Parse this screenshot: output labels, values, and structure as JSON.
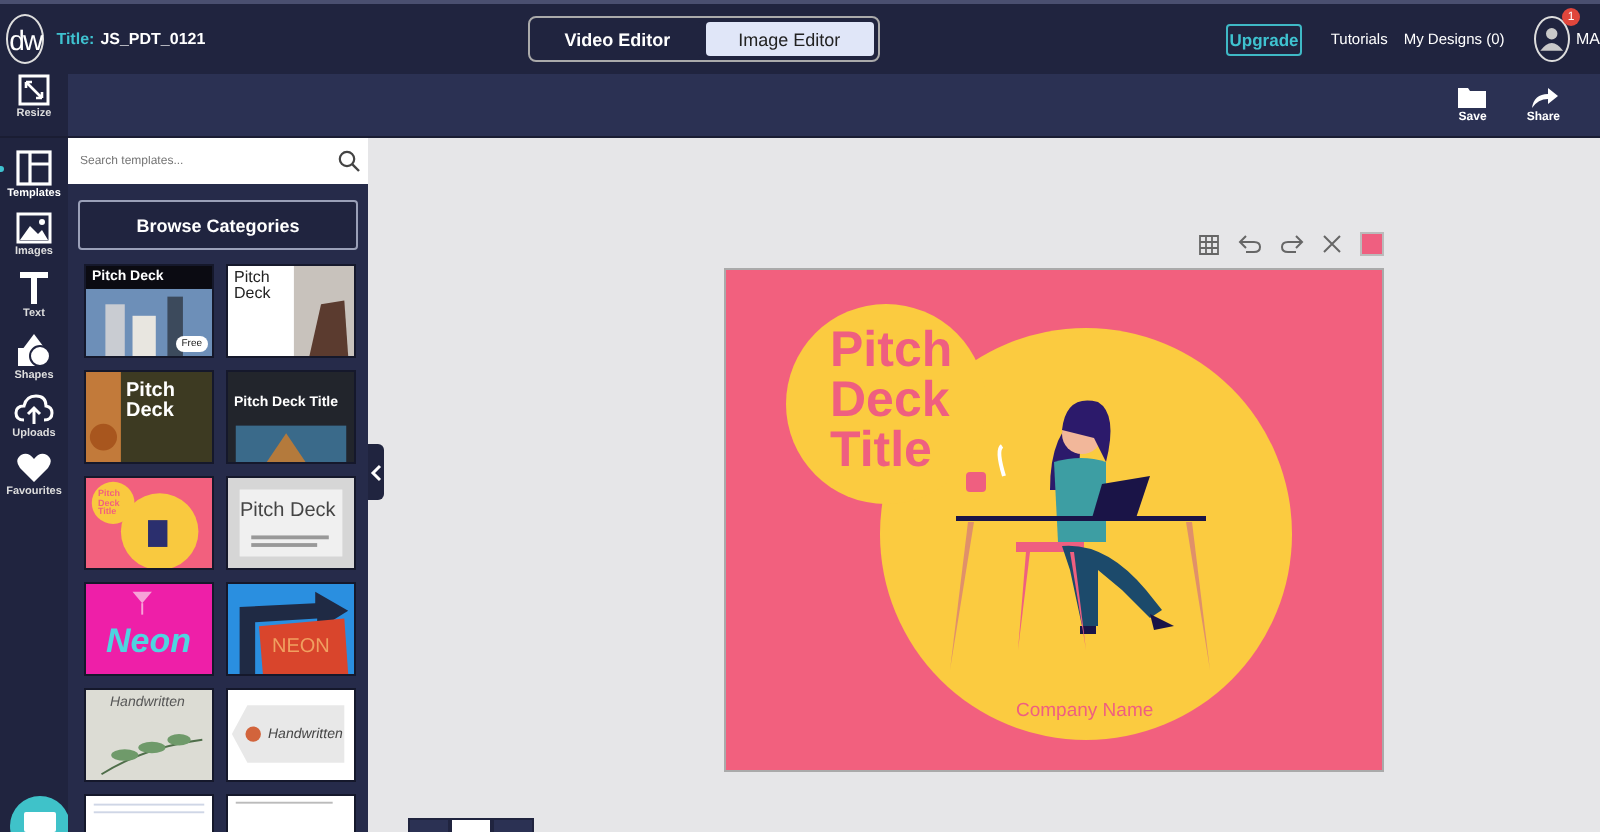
{
  "header": {
    "logo": "dw",
    "title_label": "Title:",
    "title": "JS_PDT_0121",
    "tabs": [
      {
        "label": "Video Editor",
        "selected": false
      },
      {
        "label": "Image Editor",
        "selected": true
      }
    ],
    "upgrade": "Upgrade",
    "links": [
      "Tutorials",
      "My Designs (0)"
    ],
    "notification_count": "1",
    "user_name": "MA"
  },
  "toolbar": [
    {
      "label": "Save",
      "kind": "folder"
    },
    {
      "label": "Share",
      "kind": "share"
    }
  ],
  "rail": [
    {
      "label": "Resize",
      "kind": "resize",
      "selected": false
    },
    {
      "label": "Templates",
      "kind": "templates",
      "selected": true
    },
    {
      "label": "Images",
      "kind": "images",
      "selected": false
    },
    {
      "label": "Text",
      "kind": "text",
      "selected": false
    },
    {
      "label": "Shapes",
      "kind": "shapes",
      "selected": false
    },
    {
      "label": "Uploads",
      "kind": "uploads",
      "selected": false
    },
    {
      "label": "Favourites",
      "kind": "favourites",
      "selected": false
    }
  ],
  "templates": {
    "search": {
      "placeholder": "Search templates..."
    },
    "browse": "Browse Categories",
    "items": [
      {
        "kind": "city",
        "title": "Pitch Deck",
        "badge": "Free"
      },
      {
        "kind": "white",
        "title": "Pitch Deck"
      },
      {
        "kind": "olive",
        "title": "Pitch Deck"
      },
      {
        "kind": "dark",
        "title": "Pitch Deck Title"
      },
      {
        "kind": "pink",
        "title": "Pitch Deck Title"
      },
      {
        "kind": "grey",
        "title": "Pitch Deck"
      },
      {
        "kind": "magenta",
        "title": "Neon"
      },
      {
        "kind": "sign",
        "title": "NEON"
      },
      {
        "kind": "leaves",
        "title": "Handwritten"
      },
      {
        "kind": "tag",
        "title": "Handwritten"
      },
      {
        "kind": "lines"
      },
      {
        "kind": "plain"
      }
    ]
  },
  "canvas": {
    "title": "Pitch Deck Title",
    "company": "Company Name"
  }
}
